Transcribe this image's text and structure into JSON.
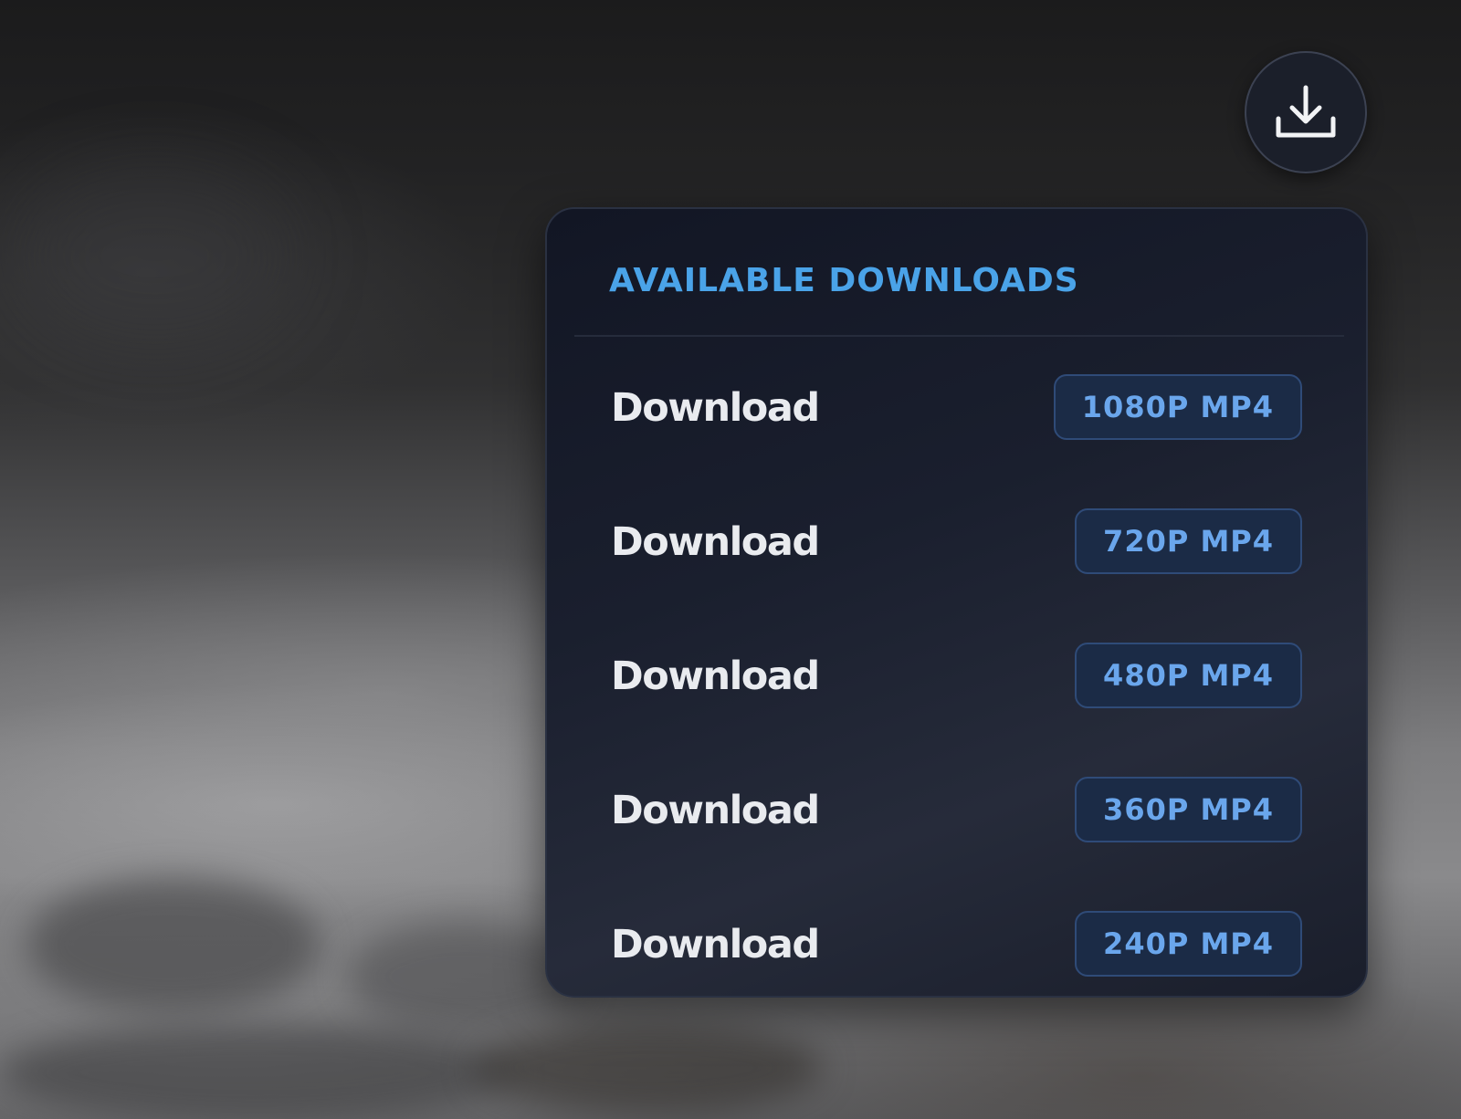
{
  "trigger": {
    "icon": "download-icon"
  },
  "menu": {
    "title": "AVAILABLE DOWNLOADS",
    "items": [
      {
        "label": "Download",
        "badge": "1080P MP4"
      },
      {
        "label": "Download",
        "badge": "720P MP4"
      },
      {
        "label": "Download",
        "badge": "480P MP4"
      },
      {
        "label": "Download",
        "badge": "360P MP4"
      },
      {
        "label": "Download",
        "badge": "240P MP4"
      }
    ]
  },
  "colors": {
    "accent": "#4aa3e8",
    "badge_text": "#6aa6ec",
    "badge_bg": "#1b2b46",
    "panel_bg": "#1a1f2e",
    "label_text": "#e9ebef"
  }
}
